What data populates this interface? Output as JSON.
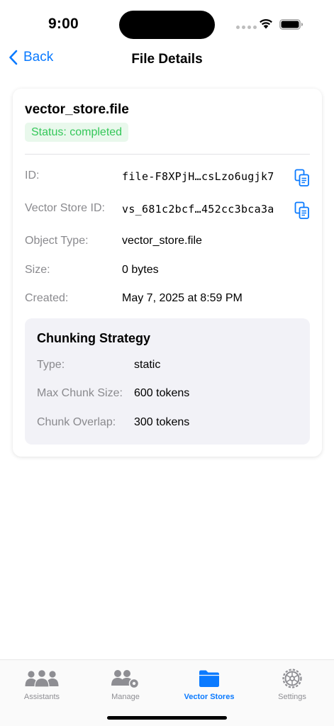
{
  "status_bar": {
    "time": "9:00"
  },
  "nav": {
    "back_label": "Back",
    "title": "File Details"
  },
  "file": {
    "name": "vector_store.file",
    "status": "Status: completed",
    "fields": {
      "id": {
        "label": "ID:",
        "value": "file-F8XPjH…csLzo6ugjk7"
      },
      "vector_store_id": {
        "label": "Vector Store ID:",
        "value": "vs_681c2bcf…452cc3bca3a"
      },
      "object_type": {
        "label": "Object Type:",
        "value": "vector_store.file"
      },
      "size": {
        "label": "Size:",
        "value": "0 bytes"
      },
      "created": {
        "label": "Created:",
        "value": "May 7, 2025 at 8:59 PM"
      }
    }
  },
  "chunking": {
    "title": "Chunking Strategy",
    "type": {
      "label": "Type:",
      "value": "static"
    },
    "max_chunk_size": {
      "label": "Max Chunk Size:",
      "value": "600 tokens"
    },
    "chunk_overlap": {
      "label": "Chunk Overlap:",
      "value": "300 tokens"
    }
  },
  "tab_bar": {
    "tabs": [
      {
        "label": "Assistants",
        "icon": "people-icon"
      },
      {
        "label": "Manage",
        "icon": "people-gear-icon"
      },
      {
        "label": "Vector Stores",
        "icon": "folder-icon"
      },
      {
        "label": "Settings",
        "icon": "gear-icon"
      }
    ],
    "active_index": 2
  },
  "colors": {
    "accent": "#0a7aff",
    "success": "#34c759",
    "secondary_text": "#8a8a8e",
    "grouped_bg": "#f2f2f7"
  }
}
